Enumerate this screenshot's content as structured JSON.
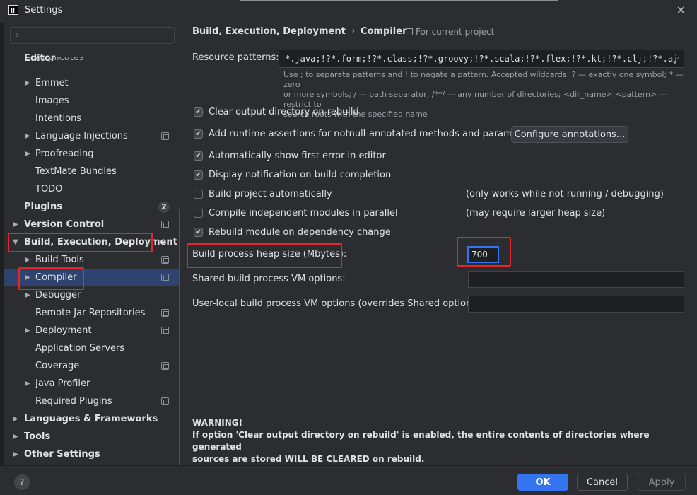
{
  "window": {
    "title": "Settings",
    "app_icon_text": "IJ",
    "close": "✕"
  },
  "sidebar": {
    "search_placeholder": "",
    "items": [
      {
        "label": "Editor",
        "bold": true
      },
      {
        "label": "Duplicates"
      },
      {
        "label": "Emmet"
      },
      {
        "label": "Images"
      },
      {
        "label": "Intentions"
      },
      {
        "label": "Language Injections"
      },
      {
        "label": "Proofreading"
      },
      {
        "label": "TextMate Bundles"
      },
      {
        "label": "TODO"
      },
      {
        "label": "Plugins",
        "badge": "2"
      },
      {
        "label": "Version Control"
      },
      {
        "label": "Build, Execution, Deployment"
      },
      {
        "label": "Build Tools"
      },
      {
        "label": "Compiler"
      },
      {
        "label": "Debugger"
      },
      {
        "label": "Remote Jar Repositories"
      },
      {
        "label": "Deployment"
      },
      {
        "label": "Application Servers"
      },
      {
        "label": "Coverage"
      },
      {
        "label": "Java Profiler"
      },
      {
        "label": "Required Plugins"
      },
      {
        "label": "Languages & Frameworks"
      },
      {
        "label": "Tools"
      },
      {
        "label": "Other Settings"
      }
    ]
  },
  "header": {
    "breadcrumb_parent": "Build, Execution, Deployment",
    "breadcrumb_sep": "›",
    "breadcrumb_current": "Compiler",
    "for_project": "For current project"
  },
  "compiler": {
    "resource_patterns_label": "Resource patterns:",
    "resource_patterns_value": "*.java;!?*.form;!?*.class;!?*.groovy;!?*.scala;!?*.flex;!?*.kt;!?*.clj;!?*.aj",
    "hint_line1": "Use ; to separate patterns and ! to negate a pattern. Accepted wildcards: ? — exactly one symbol; * — zero",
    "hint_line2": "or more symbols; / — path separator; /**/ — any number of directories; <dir_name>:<pattern> — restrict to",
    "hint_line3": "source roots with the specified name",
    "options": [
      {
        "label": "Clear output directory on rebuild",
        "checked": true
      },
      {
        "label": "Add runtime assertions for notnull-annotated methods and parameters",
        "checked": true
      },
      {
        "label": "Automatically show first error in editor",
        "checked": true
      },
      {
        "label": "Display notification on build completion",
        "checked": true
      },
      {
        "label": "Build project automatically",
        "checked": false
      },
      {
        "label": "Compile independent modules in parallel",
        "checked": false
      },
      {
        "label": "Rebuild module on dependency change",
        "checked": true
      }
    ],
    "configure_annotations": "Configure annotations...",
    "note_auto": "(only works while not running / debugging)",
    "note_parallel": "(may require larger heap size)",
    "heap_label": "Build process heap size (Mbytes):",
    "heap_value": "700",
    "shared_vm_label": "Shared build process VM options:",
    "shared_vm_value": "",
    "local_vm_label": "User-local build process VM options (overrides Shared options):",
    "local_vm_value": "",
    "warning_title": "WARNING!",
    "warning_line1": "If option 'Clear output directory on rebuild' is enabled, the entire contents of directories where generated",
    "warning_line2": "sources are stored WILL BE CLEARED on rebuild."
  },
  "footer": {
    "help": "?",
    "ok": "OK",
    "cancel": "Cancel",
    "apply": "Apply"
  },
  "colors": {
    "accent": "#3574f0",
    "highlight_box": "#e8242b",
    "selection": "#2e436e"
  }
}
